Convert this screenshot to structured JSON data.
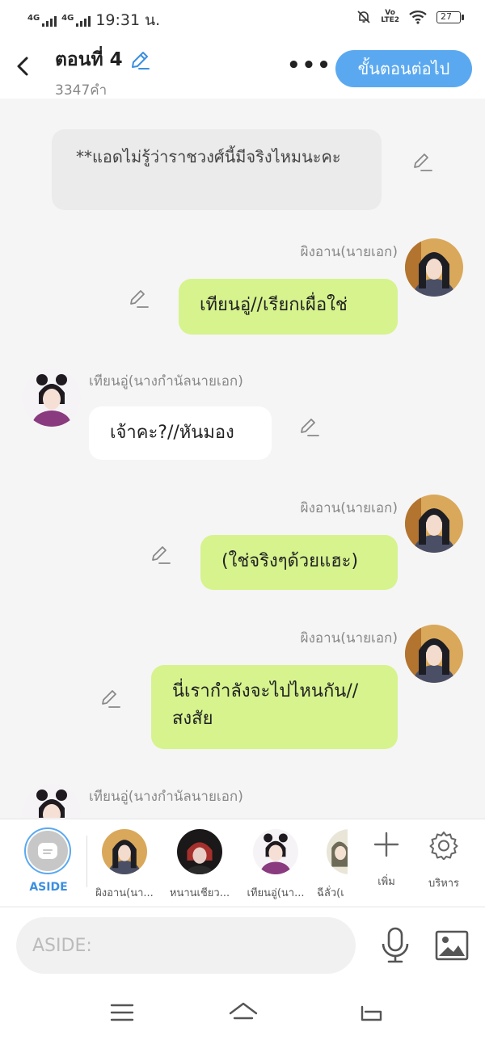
{
  "status": {
    "net1": "4G",
    "net2": "4G",
    "time": "19:31 น.",
    "volte_top": "Vo",
    "volte_bottom": "LTE2",
    "battery": "27"
  },
  "header": {
    "title": "ตอนที่ 4",
    "word_count": "3347คำ",
    "more": "•••",
    "next_button": "ขั้นตอนต่อไป"
  },
  "messages": [
    {
      "type": "aside",
      "text": "**แอดไม่รู้ว่าราชวงศ์นี้มีจริงไหมนะคะ"
    },
    {
      "type": "right",
      "name": "ผิงอาน(นายเอก)",
      "text": "เทียนอู่//เรียกเผื่อใช่"
    },
    {
      "type": "left",
      "name": "เทียนอู่(นางกำนัลนายเอก)",
      "text": "เจ้าคะ?//หันมอง"
    },
    {
      "type": "right",
      "name": "ผิงอาน(นายเอก)",
      "text": "(ใช่จริงๆด้วยแฮะ)"
    },
    {
      "type": "right",
      "name": "ผิงอาน(นายเอก)",
      "text": "นี่เรากำลังจะไปไหนกัน//สงสัย"
    },
    {
      "type": "left",
      "name": "เทียนอู่(นางกำนัลนายเอก)",
      "text": ""
    }
  ],
  "toolbar": {
    "aside_label": "ASIDE",
    "characters": [
      {
        "label": "ผิงอาน(นา..."
      },
      {
        "label": "หนานเชียว..."
      },
      {
        "label": "เทียนอู่(นา..."
      },
      {
        "label": "ฉีลั่ว(เ"
      }
    ],
    "add_label": "เพิ่ม",
    "manage_label": "บริหาร"
  },
  "input": {
    "placeholder": "ASIDE:"
  },
  "colors": {
    "accent": "#5aa9f0",
    "bubble_green": "#d6f38e",
    "background": "#f5f5f5"
  }
}
